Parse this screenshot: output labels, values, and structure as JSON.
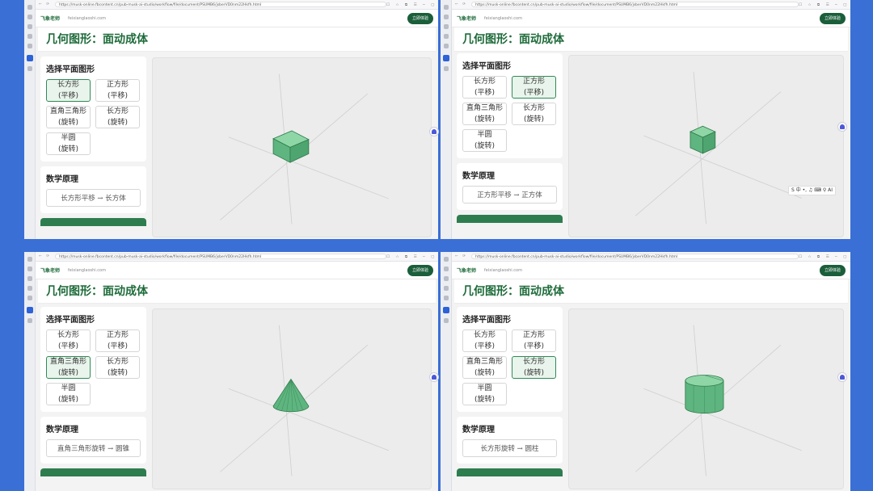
{
  "browser": {
    "url": "https://musk-online.fbcontent.cn/pub-musk-ai-studio/workflow/file/document/PSUMB6/jsberVD0nm22Hkfh.html",
    "nav_glyphs": "← ⟳",
    "action_glyphs": "☐ ☆ ⧉ ☰ ─ ▢ ✕"
  },
  "site": {
    "logo": "飞象老师",
    "domain": "feixianglaoshi.com",
    "cta_label": "立即体验"
  },
  "page": {
    "title": "几何图形：面动成体",
    "select_heading": "选择平面图形",
    "principle_heading": "数学原理"
  },
  "options": [
    {
      "label": "长方形\n(平移)"
    },
    {
      "label": "正方形\n(平移)"
    },
    {
      "label": "直角三角形\n(旋转)"
    },
    {
      "label": "长方形\n(旋转)"
    },
    {
      "label": "半圆\n(旋转)"
    }
  ],
  "panels": [
    {
      "selected": 0,
      "formula": "长方形平移 → 长方体",
      "shape": "cuboid"
    },
    {
      "selected": 1,
      "formula": "正方形平移 → 正方体",
      "shape": "cube"
    },
    {
      "selected": 2,
      "formula": "直角三角形旋转 → 圆锥",
      "shape": "cone"
    },
    {
      "selected": 3,
      "formula": "长方形旋转 → 圆柱",
      "shape": "cylinder"
    }
  ],
  "ime_toolbar": "S 中 •, ♫ ⌨ ⚲ AI",
  "colors": {
    "accent": "#1e6b3a",
    "selected_bg": "#e9f4ec",
    "shape_fill": "#6cc08a",
    "desktop": "#3a6fd6"
  }
}
